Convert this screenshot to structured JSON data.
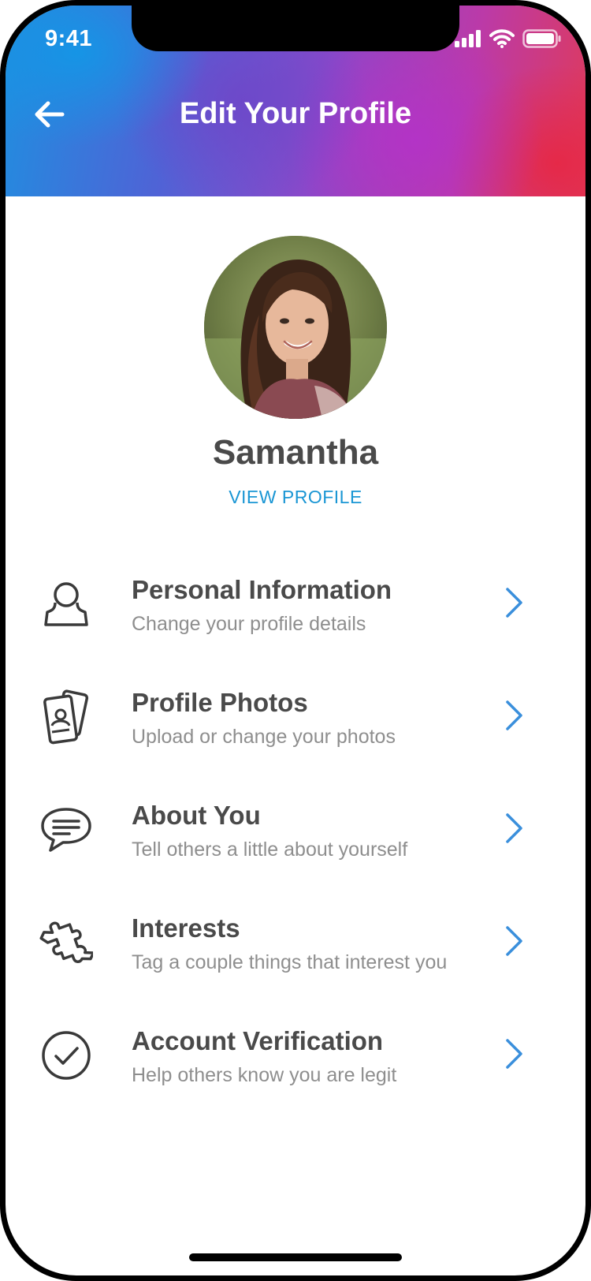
{
  "status_bar": {
    "time": "9:41",
    "icons": [
      "signal-icon",
      "wifi-icon",
      "battery-icon"
    ]
  },
  "header": {
    "title": "Edit Your Profile",
    "back_icon": "back-arrow-icon"
  },
  "profile": {
    "name": "Samantha",
    "view_profile_label": "VIEW PROFILE"
  },
  "menu": {
    "items": [
      {
        "title": "Personal Information",
        "subtitle": "Change your profile details",
        "icon": "person-icon"
      },
      {
        "title": "Profile Photos",
        "subtitle": "Upload or change your photos",
        "icon": "photos-icon"
      },
      {
        "title": "About You",
        "subtitle": "Tell others a little about yourself",
        "icon": "chat-bubble-icon"
      },
      {
        "title": "Interests",
        "subtitle": "Tag a couple things that interest you",
        "icon": "puzzle-icon"
      },
      {
        "title": "Account Verification",
        "subtitle": "Help others know you are legit",
        "icon": "check-circle-icon"
      }
    ]
  },
  "colors": {
    "accent": "#1a96d4",
    "chevron": "#3a8fdc",
    "title_text": "#4a4a4a",
    "subtitle_text": "#8e8e8e",
    "icon_stroke": "#3a3a3a"
  }
}
